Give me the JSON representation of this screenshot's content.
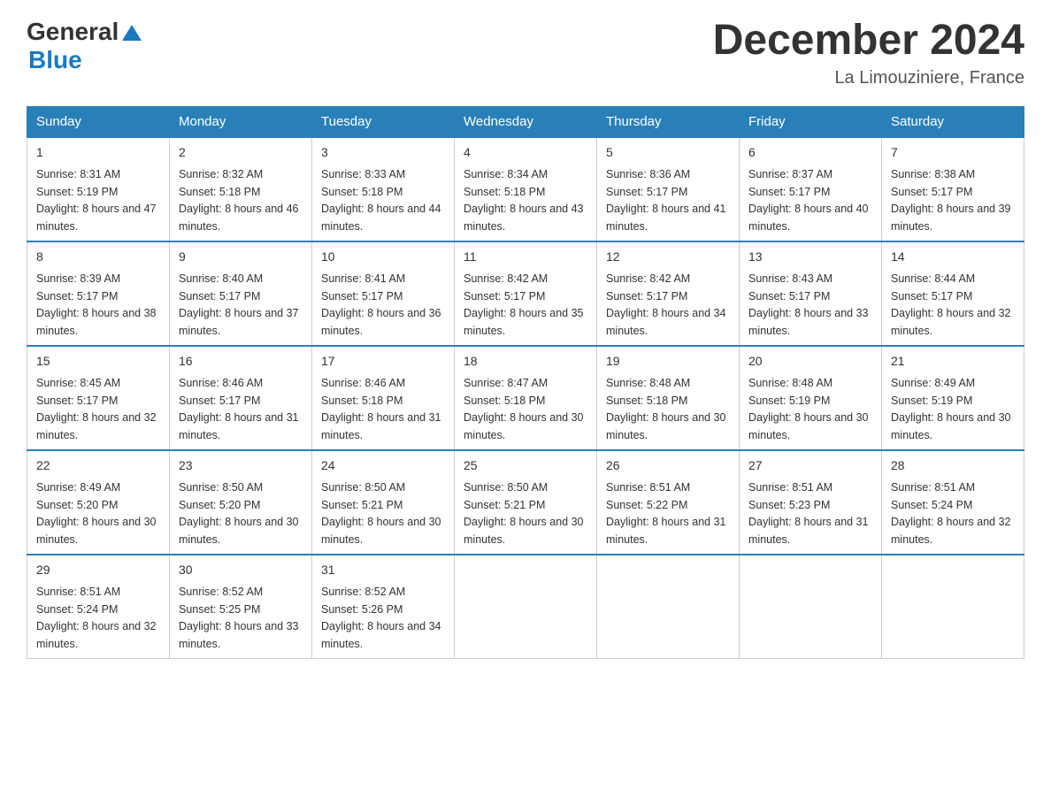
{
  "header": {
    "logo_general": "General",
    "logo_blue": "Blue",
    "title": "December 2024",
    "location": "La Limouziniere, France"
  },
  "calendar": {
    "days_of_week": [
      "Sunday",
      "Monday",
      "Tuesday",
      "Wednesday",
      "Thursday",
      "Friday",
      "Saturday"
    ],
    "weeks": [
      [
        {
          "day": "1",
          "sunrise": "8:31 AM",
          "sunset": "5:19 PM",
          "daylight": "8 hours and 47 minutes."
        },
        {
          "day": "2",
          "sunrise": "8:32 AM",
          "sunset": "5:18 PM",
          "daylight": "8 hours and 46 minutes."
        },
        {
          "day": "3",
          "sunrise": "8:33 AM",
          "sunset": "5:18 PM",
          "daylight": "8 hours and 44 minutes."
        },
        {
          "day": "4",
          "sunrise": "8:34 AM",
          "sunset": "5:18 PM",
          "daylight": "8 hours and 43 minutes."
        },
        {
          "day": "5",
          "sunrise": "8:36 AM",
          "sunset": "5:17 PM",
          "daylight": "8 hours and 41 minutes."
        },
        {
          "day": "6",
          "sunrise": "8:37 AM",
          "sunset": "5:17 PM",
          "daylight": "8 hours and 40 minutes."
        },
        {
          "day": "7",
          "sunrise": "8:38 AM",
          "sunset": "5:17 PM",
          "daylight": "8 hours and 39 minutes."
        }
      ],
      [
        {
          "day": "8",
          "sunrise": "8:39 AM",
          "sunset": "5:17 PM",
          "daylight": "8 hours and 38 minutes."
        },
        {
          "day": "9",
          "sunrise": "8:40 AM",
          "sunset": "5:17 PM",
          "daylight": "8 hours and 37 minutes."
        },
        {
          "day": "10",
          "sunrise": "8:41 AM",
          "sunset": "5:17 PM",
          "daylight": "8 hours and 36 minutes."
        },
        {
          "day": "11",
          "sunrise": "8:42 AM",
          "sunset": "5:17 PM",
          "daylight": "8 hours and 35 minutes."
        },
        {
          "day": "12",
          "sunrise": "8:42 AM",
          "sunset": "5:17 PM",
          "daylight": "8 hours and 34 minutes."
        },
        {
          "day": "13",
          "sunrise": "8:43 AM",
          "sunset": "5:17 PM",
          "daylight": "8 hours and 33 minutes."
        },
        {
          "day": "14",
          "sunrise": "8:44 AM",
          "sunset": "5:17 PM",
          "daylight": "8 hours and 32 minutes."
        }
      ],
      [
        {
          "day": "15",
          "sunrise": "8:45 AM",
          "sunset": "5:17 PM",
          "daylight": "8 hours and 32 minutes."
        },
        {
          "day": "16",
          "sunrise": "8:46 AM",
          "sunset": "5:17 PM",
          "daylight": "8 hours and 31 minutes."
        },
        {
          "day": "17",
          "sunrise": "8:46 AM",
          "sunset": "5:18 PM",
          "daylight": "8 hours and 31 minutes."
        },
        {
          "day": "18",
          "sunrise": "8:47 AM",
          "sunset": "5:18 PM",
          "daylight": "8 hours and 30 minutes."
        },
        {
          "day": "19",
          "sunrise": "8:48 AM",
          "sunset": "5:18 PM",
          "daylight": "8 hours and 30 minutes."
        },
        {
          "day": "20",
          "sunrise": "8:48 AM",
          "sunset": "5:19 PM",
          "daylight": "8 hours and 30 minutes."
        },
        {
          "day": "21",
          "sunrise": "8:49 AM",
          "sunset": "5:19 PM",
          "daylight": "8 hours and 30 minutes."
        }
      ],
      [
        {
          "day": "22",
          "sunrise": "8:49 AM",
          "sunset": "5:20 PM",
          "daylight": "8 hours and 30 minutes."
        },
        {
          "day": "23",
          "sunrise": "8:50 AM",
          "sunset": "5:20 PM",
          "daylight": "8 hours and 30 minutes."
        },
        {
          "day": "24",
          "sunrise": "8:50 AM",
          "sunset": "5:21 PM",
          "daylight": "8 hours and 30 minutes."
        },
        {
          "day": "25",
          "sunrise": "8:50 AM",
          "sunset": "5:21 PM",
          "daylight": "8 hours and 30 minutes."
        },
        {
          "day": "26",
          "sunrise": "8:51 AM",
          "sunset": "5:22 PM",
          "daylight": "8 hours and 31 minutes."
        },
        {
          "day": "27",
          "sunrise": "8:51 AM",
          "sunset": "5:23 PM",
          "daylight": "8 hours and 31 minutes."
        },
        {
          "day": "28",
          "sunrise": "8:51 AM",
          "sunset": "5:24 PM",
          "daylight": "8 hours and 32 minutes."
        }
      ],
      [
        {
          "day": "29",
          "sunrise": "8:51 AM",
          "sunset": "5:24 PM",
          "daylight": "8 hours and 32 minutes."
        },
        {
          "day": "30",
          "sunrise": "8:52 AM",
          "sunset": "5:25 PM",
          "daylight": "8 hours and 33 minutes."
        },
        {
          "day": "31",
          "sunrise": "8:52 AM",
          "sunset": "5:26 PM",
          "daylight": "8 hours and 34 minutes."
        },
        null,
        null,
        null,
        null
      ]
    ]
  }
}
